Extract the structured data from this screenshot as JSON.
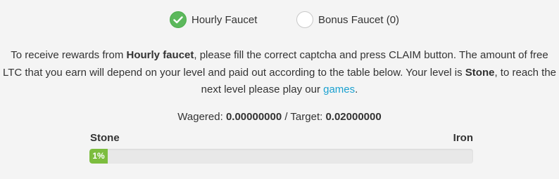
{
  "tabs": {
    "hourly_label": "Hourly Faucet",
    "hourly_checked": true,
    "bonus_label": "Bonus Faucet (0)",
    "bonus_checked": false
  },
  "info": {
    "part1": "To receive rewards from ",
    "bold1": "Hourly faucet",
    "part2": ", please fill the correct captcha and press CLAIM button. The amount of free LTC that you earn will depend on your level and paid out according to the table below. Your level is ",
    "bold2": "Stone",
    "part3": ", to reach the next level please play our ",
    "link": "games",
    "part4": "."
  },
  "wager": {
    "wagered_label": "Wagered: ",
    "wagered_value": "0.00000000",
    "separator": " / Target: ",
    "target_value": "0.02000000"
  },
  "levels": {
    "current": "Stone",
    "next": "Iron"
  },
  "progress": {
    "percent": 1,
    "label": "1%"
  },
  "colors": {
    "checked": "#5cb85c",
    "progress": "#7cbd3e",
    "link": "#1ba1d0"
  }
}
